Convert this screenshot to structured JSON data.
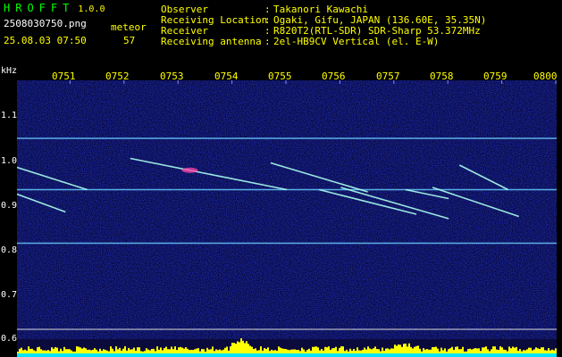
{
  "header": {
    "app_name": "HROFFT",
    "version": "1.0.0",
    "filename": "2508030750.png",
    "datetime": "25.08.03 07:50",
    "count_label": "meteor",
    "count_value": "57",
    "info": [
      {
        "label": "Observer",
        "sep": ":",
        "value": "Takanori Kawachi"
      },
      {
        "label": "Receiving Location",
        "sep": ":",
        "value": "Ogaki, Gifu, JAPAN (136.60E, 35.35N)"
      },
      {
        "label": "Receiver",
        "sep": ":",
        "value": "R820T2(RTL-SDR) SDR-Sharp 53.372MHz"
      },
      {
        "label": "Receiving antenna",
        "sep": ":",
        "value": "2el-HB9CV Vertical (el. E-W)"
      }
    ]
  },
  "axes": {
    "y_unit": "kHz",
    "y_ticks": [
      "1.1",
      "1.0",
      "0.9",
      "0.8",
      "0.7",
      "0.6"
    ],
    "x_ticks": [
      "0751",
      "0752",
      "0753",
      "0754",
      "0755",
      "0756",
      "0757",
      "0758",
      "0759",
      "0800"
    ]
  },
  "colors": {
    "background": "#000000",
    "spectrogram_bg": "#0a0a3c",
    "carrier": "#66ccff",
    "meteor_trail": "#aaffee",
    "meteor_hot": "#ff44aa",
    "echo_level": "#ffff00",
    "echo_level_base": "#00e5ff",
    "header_brand": "#00ff00",
    "header_text": "#ffff00",
    "header_info": "#ffffff"
  },
  "signals": {
    "carriers_khz": [
      1.05,
      0.935,
      0.815
    ],
    "meteor_trails": [
      {
        "start_min": 0.0,
        "start_khz": 0.985,
        "end_min": 1.3,
        "end_khz": 0.935
      },
      {
        "start_min": 0.0,
        "start_khz": 0.925,
        "end_min": 0.9,
        "end_khz": 0.885
      },
      {
        "start_min": 2.1,
        "start_khz": 1.005,
        "end_min": 5.0,
        "end_khz": 0.935
      },
      {
        "start_min": 4.7,
        "start_khz": 0.995,
        "end_min": 6.5,
        "end_khz": 0.93
      },
      {
        "start_min": 5.6,
        "start_khz": 0.935,
        "end_min": 7.4,
        "end_khz": 0.88
      },
      {
        "start_min": 6.0,
        "start_khz": 0.94,
        "end_min": 8.0,
        "end_khz": 0.87
      },
      {
        "start_min": 8.2,
        "start_khz": 0.99,
        "end_min": 9.1,
        "end_khz": 0.935
      },
      {
        "start_min": 7.7,
        "start_khz": 0.94,
        "end_min": 9.3,
        "end_khz": 0.875
      },
      {
        "start_min": 7.2,
        "start_khz": 0.935,
        "end_min": 8.0,
        "end_khz": 0.915
      }
    ]
  }
}
